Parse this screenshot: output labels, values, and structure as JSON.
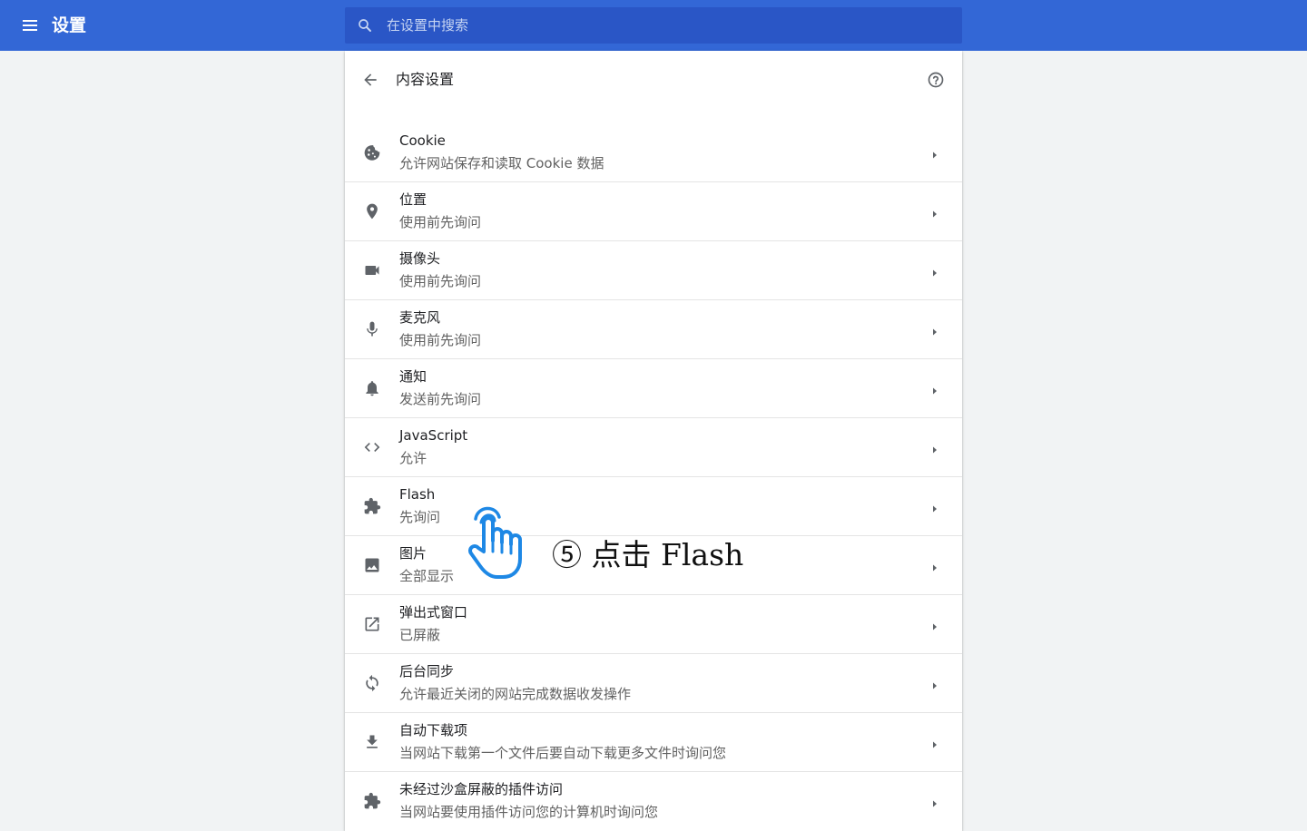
{
  "header": {
    "title": "设置",
    "menu_icon": "menu-icon",
    "search_placeholder": "在设置中搜索",
    "search_value": "",
    "color": "#3367d6"
  },
  "content_settings": {
    "title": "内容设置",
    "back_icon": "arrow-back-icon",
    "help_icon": "help-icon",
    "items": [
      {
        "icon": "cookie-icon",
        "title": "Cookie",
        "subtitle": "允许网站保存和读取 Cookie 数据"
      },
      {
        "icon": "location-pin-icon",
        "title": "位置",
        "subtitle": "使用前先询问"
      },
      {
        "icon": "camera-icon",
        "title": "摄像头",
        "subtitle": "使用前先询问"
      },
      {
        "icon": "microphone-icon",
        "title": "麦克风",
        "subtitle": "使用前先询问"
      },
      {
        "icon": "bell-icon",
        "title": "通知",
        "subtitle": "发送前先询问"
      },
      {
        "icon": "code-icon",
        "title": "JavaScript",
        "subtitle": "允许"
      },
      {
        "icon": "puzzle-icon",
        "title": "Flash",
        "subtitle": "先询问"
      },
      {
        "icon": "image-icon",
        "title": "图片",
        "subtitle": "全部显示"
      },
      {
        "icon": "open-in-new-icon",
        "title": "弹出式窗口",
        "subtitle": "已屏蔽"
      },
      {
        "icon": "sync-icon",
        "title": "后台同步",
        "subtitle": "允许最近关闭的网站完成数据收发操作"
      },
      {
        "icon": "download-icon",
        "title": "自动下载项",
        "subtitle": "当网站下载第一个文件后要自动下载更多文件时询问您"
      },
      {
        "icon": "puzzle-icon",
        "title": "未经过沙盒屏蔽的插件访问",
        "subtitle": "当网站要使用插件访问您的计算机时询问您"
      }
    ]
  },
  "annotation": {
    "caption": "⑤ 点击 Flash",
    "pointer_icon": "hand-pointer-icon",
    "pointer_color": "#1e88e5"
  }
}
